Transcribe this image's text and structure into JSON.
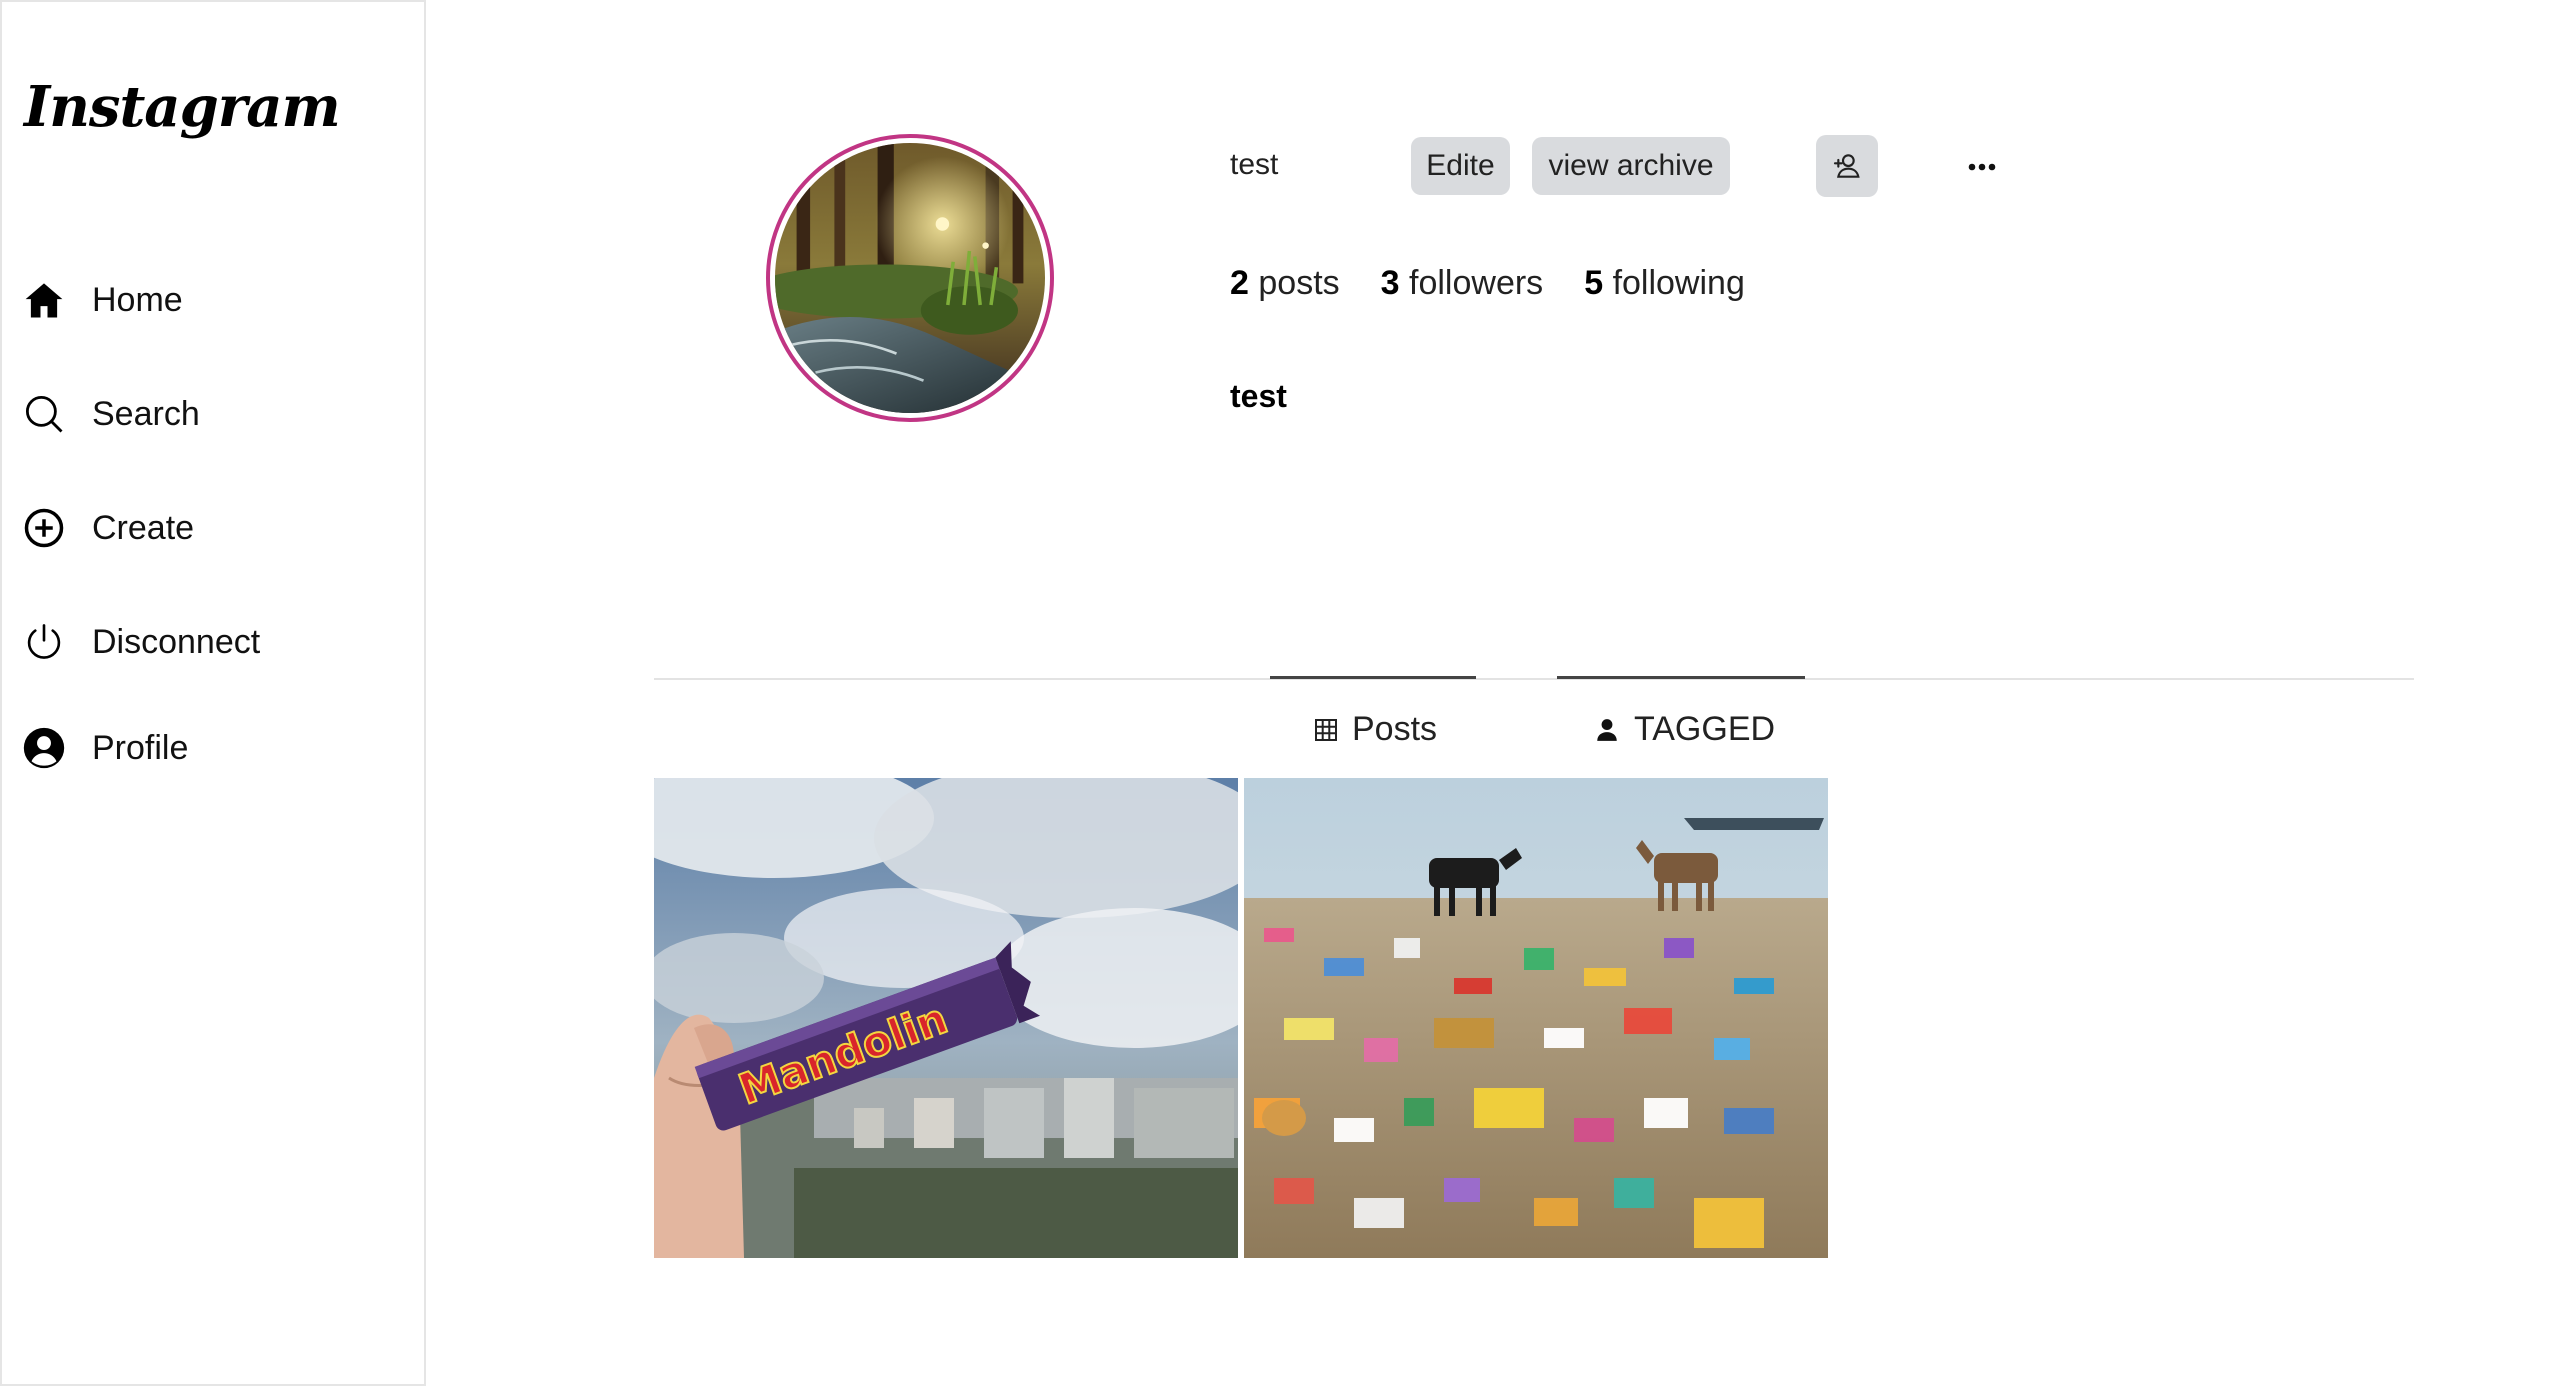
{
  "app": {
    "logo_text": "Instagram"
  },
  "sidebar": {
    "items": [
      {
        "label": "Home",
        "icon": "home-icon"
      },
      {
        "label": "Search",
        "icon": "search-icon"
      },
      {
        "label": "Create",
        "icon": "plus-circle-icon"
      },
      {
        "label": "Disconnect",
        "icon": "power-icon"
      },
      {
        "label": "Profile",
        "icon": "user-circle-icon"
      }
    ]
  },
  "profile": {
    "username": "test",
    "edit_label": "Edite",
    "archive_label": "view archive",
    "posts_count": "2",
    "posts_label": "posts",
    "followers_count": "3",
    "followers_label": "followers",
    "following_count": "5",
    "following_label": "following",
    "display_name": "test"
  },
  "tabs": [
    {
      "label": "Posts",
      "icon": "grid-icon",
      "active": true
    },
    {
      "label": "TAGGED",
      "icon": "person-icon",
      "active": true
    }
  ],
  "posts": [
    {
      "image": "hand holding Mandolin chocolate bar against cloudy sky"
    },
    {
      "image": "goats on beach covered with plastic trash"
    }
  ],
  "colors": {
    "avatar_ring": "#c13584",
    "button_bg": "#d9dbde",
    "divider": "#e3e3e3"
  }
}
